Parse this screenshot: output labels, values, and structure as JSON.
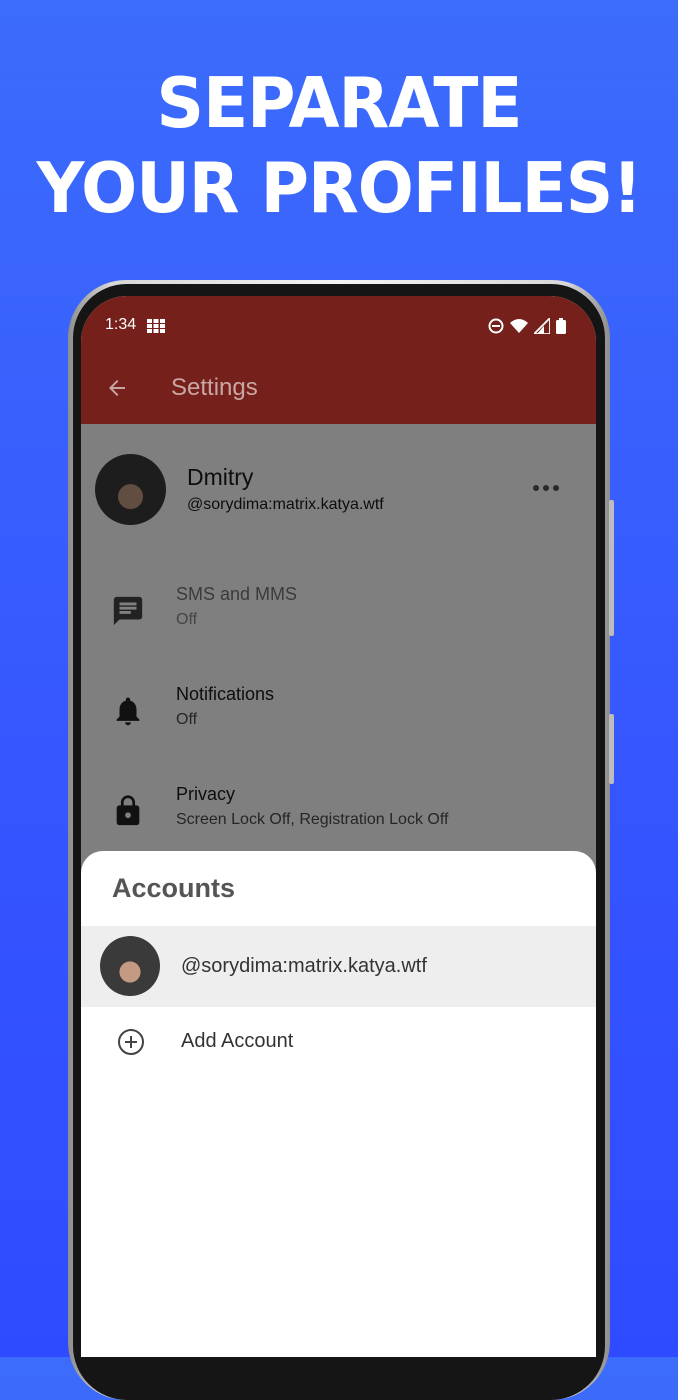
{
  "promo": {
    "line1": "SEPARATE",
    "line2": "YOUR PROFILES!"
  },
  "status_bar": {
    "time": "1:34",
    "icons": [
      "grid-icon",
      "do-not-disturb-icon",
      "wifi-icon",
      "signal-icon",
      "battery-icon"
    ]
  },
  "app_bar": {
    "title": "Settings",
    "back_icon": "arrow-back-icon",
    "color": "#75201a"
  },
  "profile": {
    "name": "Dmitry",
    "handle": "@sorydima:matrix.katya.wtf"
  },
  "settings_items": [
    {
      "title": "SMS and MMS",
      "subtitle": "Off",
      "icon": "message-icon"
    },
    {
      "title": "Notifications",
      "subtitle": "Off",
      "icon": "bell-icon"
    },
    {
      "title": "Privacy",
      "subtitle": "Screen Lock Off, Registration Lock Off",
      "icon": "lock-icon"
    }
  ],
  "accounts_sheet": {
    "title": "Accounts",
    "accounts": [
      {
        "handle": "@sorydima:matrix.katya.wtf"
      }
    ],
    "add_label": "Add Account"
  },
  "colors": {
    "background": "#3555ff",
    "app_bar": "#75201a",
    "selected_row": "#eeeeee"
  }
}
